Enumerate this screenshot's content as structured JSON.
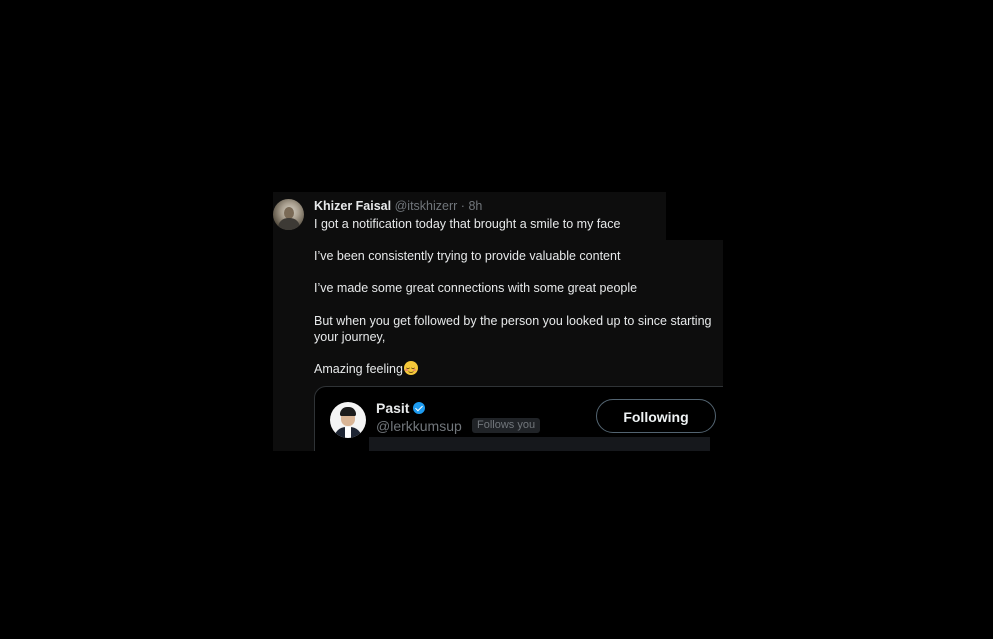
{
  "tweet": {
    "author_name": "Khizer Faisal",
    "author_handle": "@itskhizerr",
    "separator": "·",
    "timestamp": "8h",
    "lines": [
      "I got a notification today that brought a smile to my face",
      "I’ve been consistently trying to provide valuable content",
      "I’ve made some great connections with some great people",
      "But when you get followed by the person you looked up to since starting",
      "your journey,",
      "Amazing feeling"
    ],
    "emoji": "relieved-face-emoji"
  },
  "embedded_card": {
    "name": "Pasit",
    "verified_icon": "verified-badge-icon",
    "handle": "@lerkkumsup",
    "follows_badge": "Follows you",
    "follow_button_label": "Following"
  },
  "colors": {
    "background": "#000000",
    "panel": "#0d0d0d",
    "primary_text": "#e7e9ea",
    "secondary_text": "#71767b",
    "verified_blue": "#1d9bf0"
  }
}
